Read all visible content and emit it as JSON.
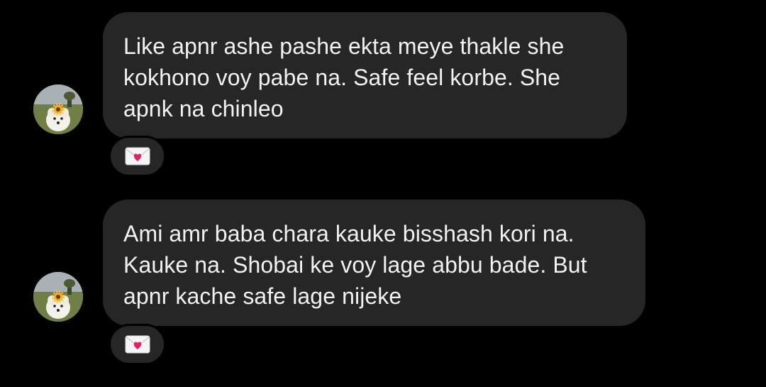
{
  "messages": [
    {
      "sender_avatar": "dog-with-sunflower-avatar",
      "text": "Like apnr ashe pashe ekta meye thakle she\nkokhono voy pabe na. Safe feel korbe. She\napnk na chinleo",
      "reaction": "love-letter-emoji"
    },
    {
      "sender_avatar": "dog-with-sunflower-avatar",
      "text": "Ami amr baba chara kauke bisshash kori na.\nKauke na. Shobai ke voy lage abbu bade. But\napnr kache safe lage nijeke",
      "reaction": "love-letter-emoji"
    }
  ],
  "colors": {
    "background": "#000000",
    "bubble": "#262626",
    "text": "#f2f2f2",
    "heart": "#e0245e"
  }
}
